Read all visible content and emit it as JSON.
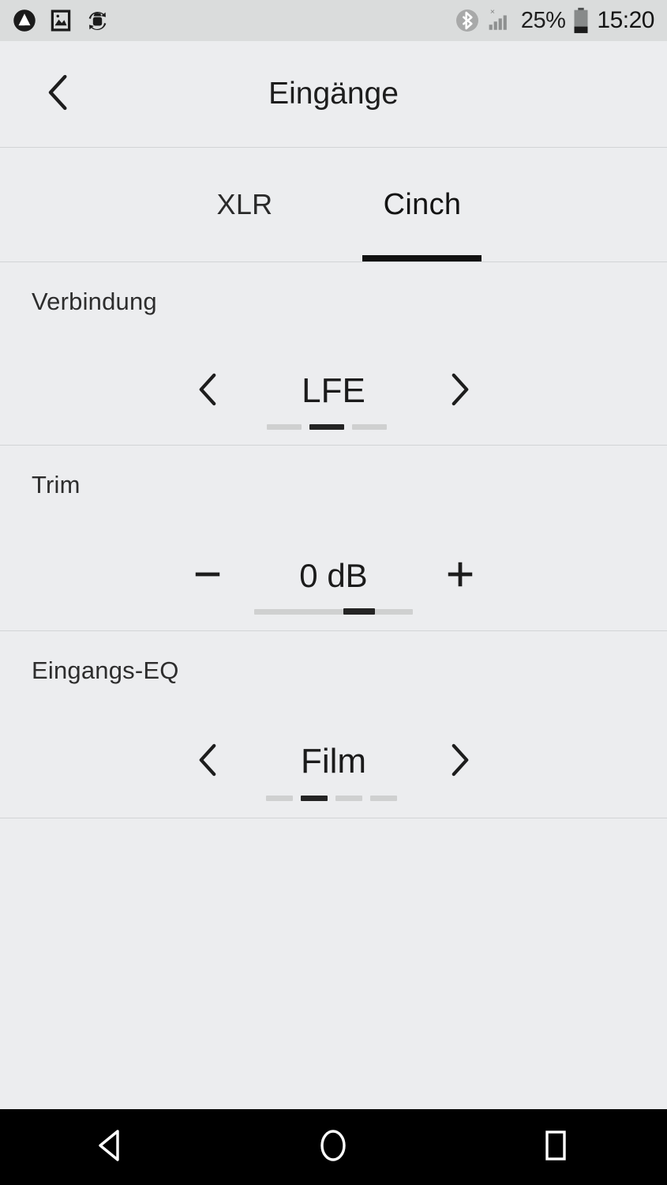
{
  "status_bar": {
    "icons_left": [
      "droplet-circle-icon",
      "photo-icon",
      "android-sync-icon"
    ],
    "bluetooth_icon": "bluetooth-icon",
    "signal_icon": "signal-bars-no-sim-icon",
    "battery_percent": "25%",
    "battery_icon": "battery-low-icon",
    "time": "15:20"
  },
  "header": {
    "back_icon": "chevron-left-icon",
    "title": "Eingänge"
  },
  "tabs": [
    {
      "label": "XLR",
      "active": false
    },
    {
      "label": "Cinch",
      "active": true
    }
  ],
  "sections": [
    {
      "label": "Verbindung",
      "control": "stepper-segmented",
      "prev_icon": "chevron-left-icon",
      "next_icon": "chevron-right-icon",
      "value": "LFE",
      "segments_total": 3,
      "segment_active_index": 1
    },
    {
      "label": "Trim",
      "control": "stepper-slider",
      "prev_icon": "minus-icon",
      "next_icon": "plus-icon",
      "value": "0 dB",
      "slider_position_percent": 70
    },
    {
      "label": "Eingangs-EQ",
      "control": "stepper-segmented",
      "prev_icon": "chevron-left-icon",
      "next_icon": "chevron-right-icon",
      "value": "Film",
      "segments_total": 4,
      "segment_active_index": 1
    }
  ],
  "nav_bar": {
    "back_icon": "nav-back-triangle-icon",
    "home_icon": "nav-home-circle-icon",
    "recents_icon": "nav-recents-square-icon"
  },
  "colors": {
    "page_background": "#ecedef",
    "status_bar_background": "#dadcdc",
    "accent_dark": "#242424",
    "inactive_segment": "#cfd0d0",
    "divider": "#d2d4d6",
    "nav_bar_background": "#000000"
  }
}
